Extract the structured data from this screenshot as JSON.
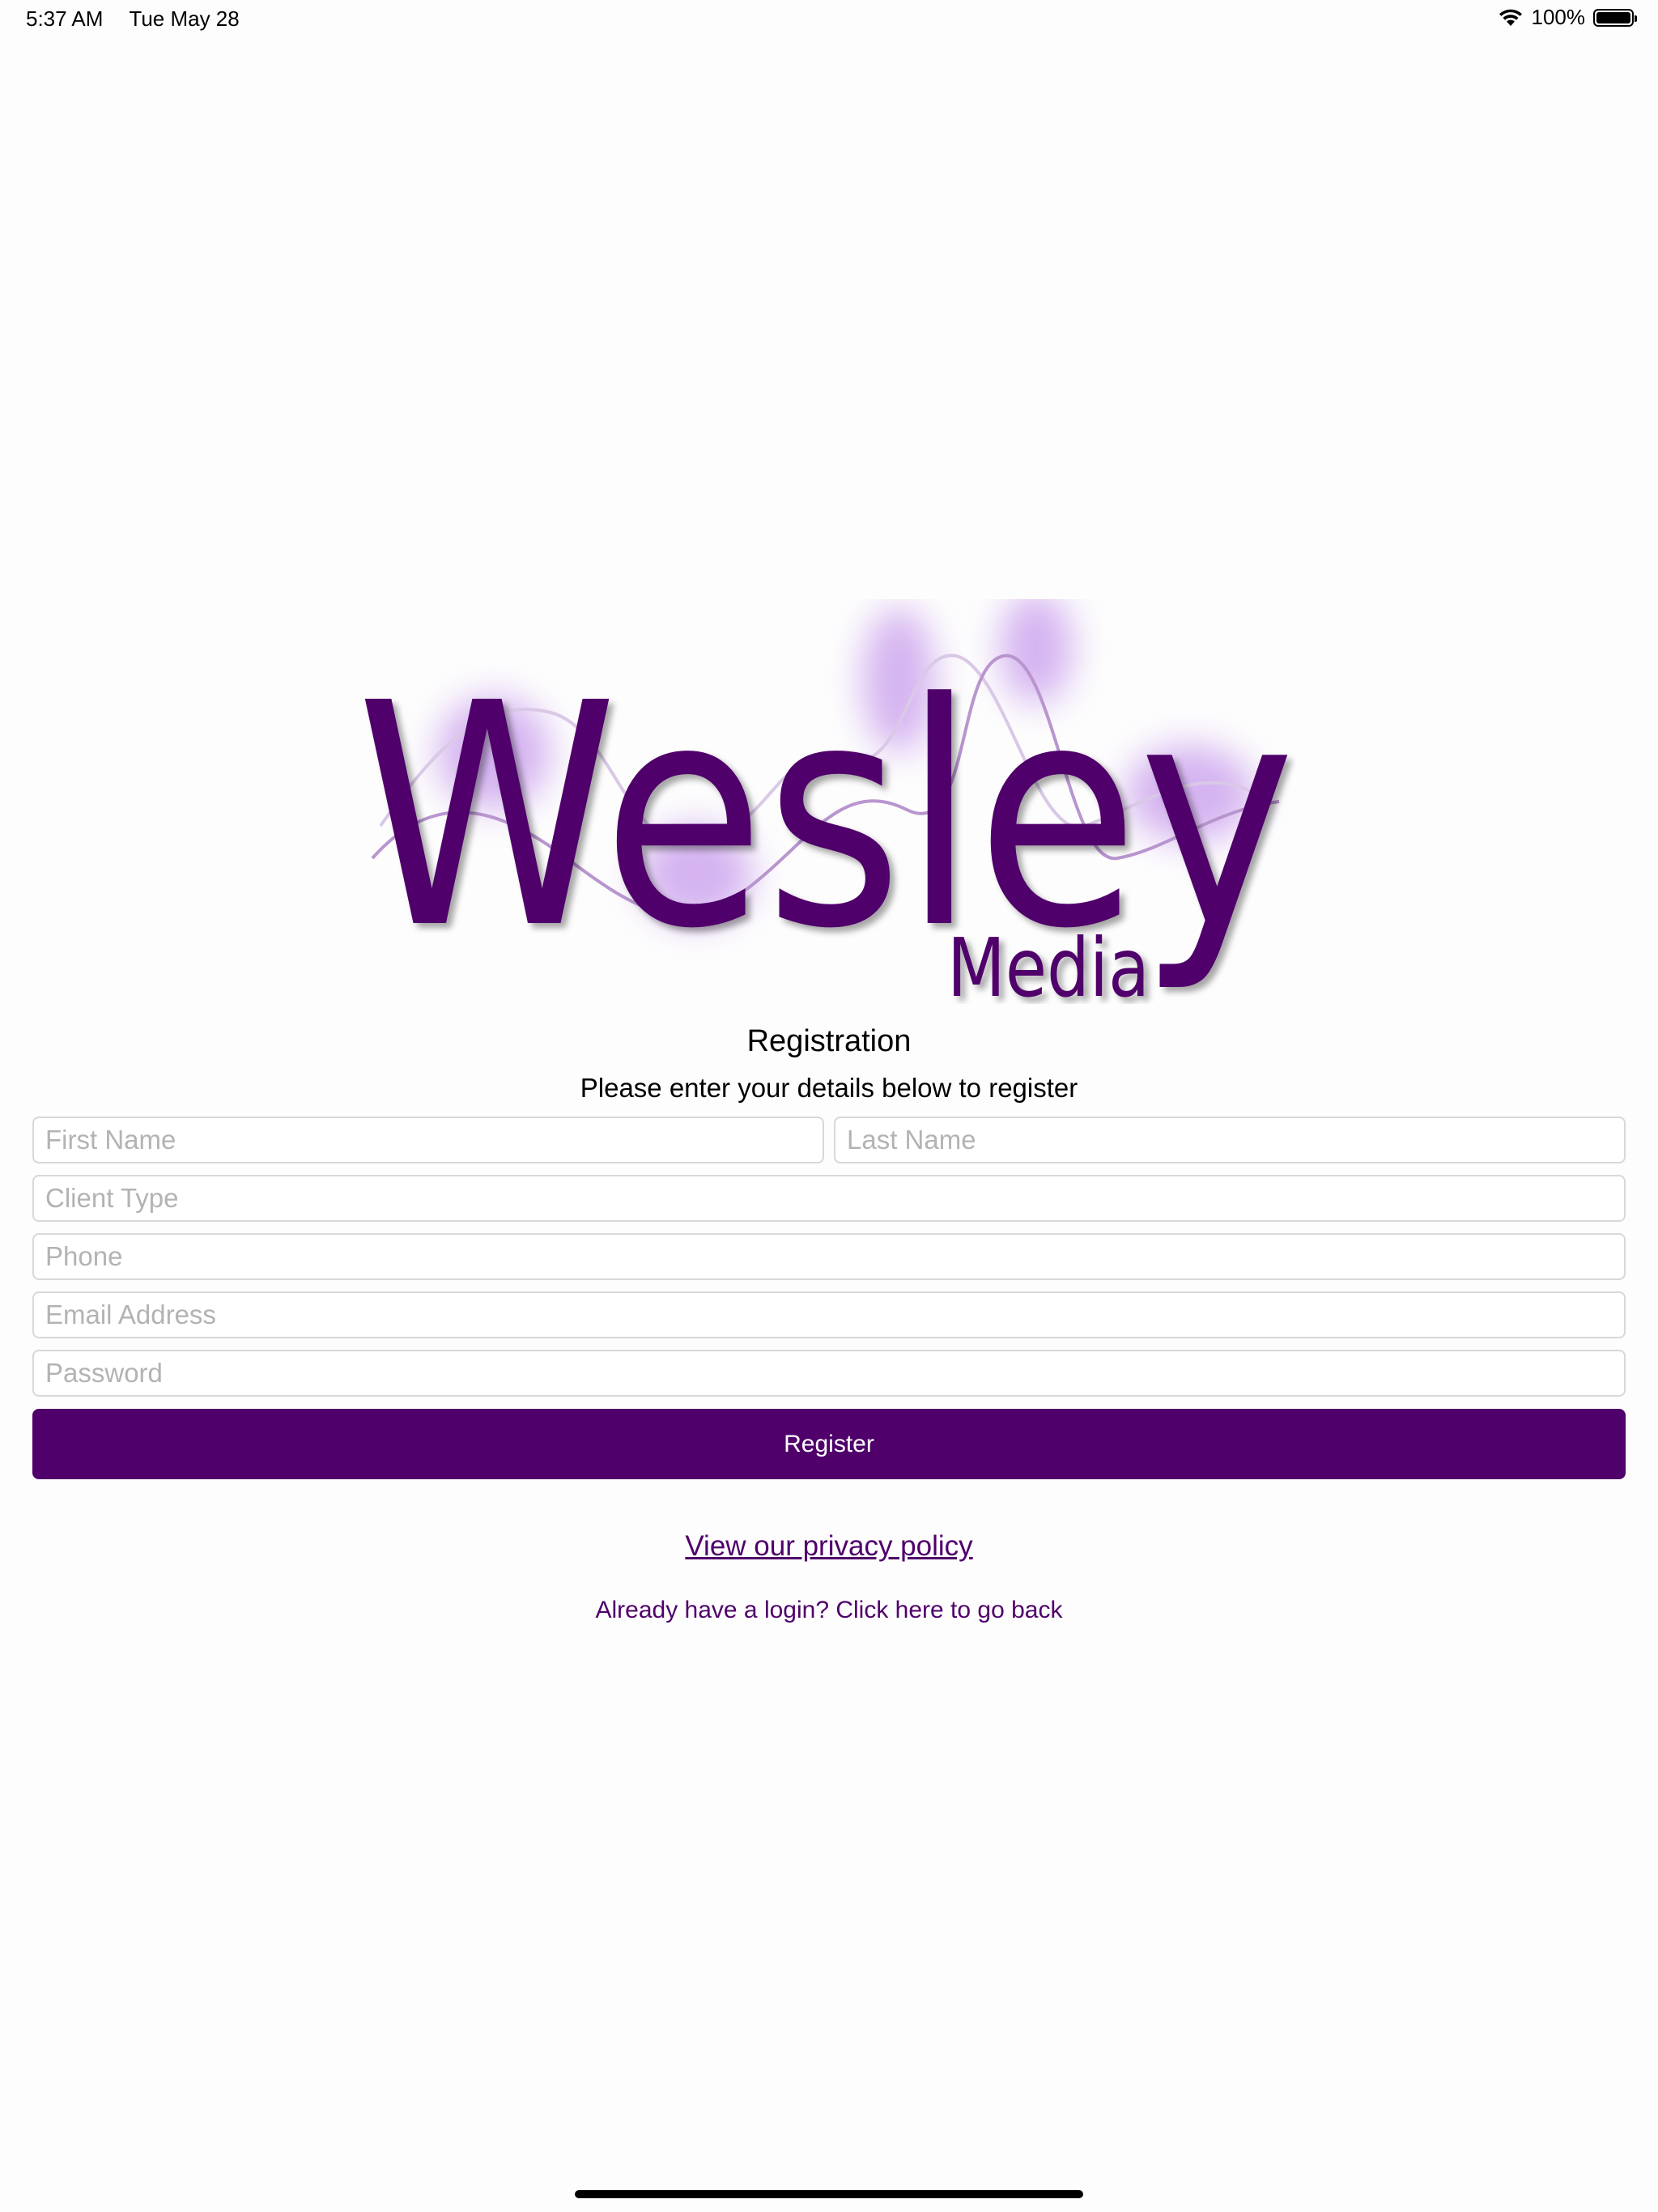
{
  "status_bar": {
    "time": "5:37 AM",
    "date": "Tue May 28",
    "battery_percent": "100%",
    "battery_level": 1.0
  },
  "logo": {
    "wordmark": "Wesley",
    "subtext": "Media",
    "brand_color": "#4f006a"
  },
  "form": {
    "title": "Registration",
    "subtitle": "Please enter your details below to register",
    "first_name_placeholder": "First Name",
    "last_name_placeholder": "Last Name",
    "client_type_placeholder": "Client Type",
    "phone_placeholder": "Phone",
    "email_placeholder": "Email Address",
    "password_placeholder": "Password",
    "register_label": "Register"
  },
  "links": {
    "privacy": "View our privacy policy",
    "back": "Already have a login? Click here to go back"
  }
}
